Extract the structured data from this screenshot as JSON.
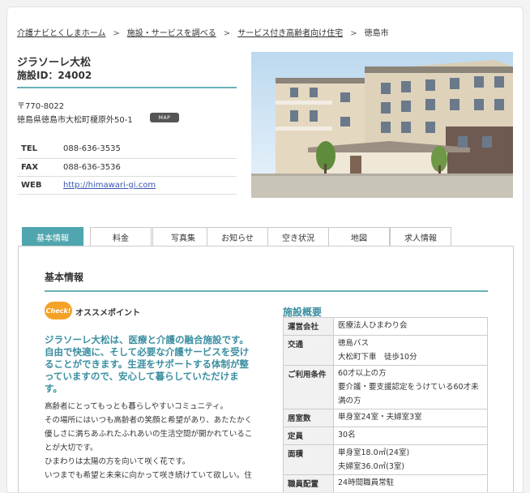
{
  "breadcrumb": {
    "items": [
      "介護ナビとくしまホーム",
      "施設・サービスを調べる",
      "サービス付き高齢者向け住宅",
      "徳島市"
    ],
    "separator": ">"
  },
  "facility": {
    "name": "ジラソーレ大松",
    "id_label": "施設ID：24002",
    "zip": "〒770-8022",
    "address": "徳島県徳島市大松町榎原外50-1",
    "map_label": "MAP",
    "contact": [
      {
        "key": "TEL",
        "value": "088-636-3535"
      },
      {
        "key": "FAX",
        "value": "088-636-3536"
      },
      {
        "key": "WEB",
        "value": "http://himawari-gi.com"
      }
    ]
  },
  "tabs": [
    "基本情報",
    "料金",
    "写真集",
    "お知らせ",
    "空き状況",
    "地図",
    "求人情報"
  ],
  "active_tab": "基本情報",
  "section": {
    "title": "基本情報",
    "check_badge": "Check!",
    "osusume_label": "オススメポイント",
    "lead": "ジラソーレ大松は、医療と介護の融合施設です。自由で快適に、そして必要な介護サービスを受けることができます。生涯をサポートする体制が整っていますので、安心して暮らしていただけます。",
    "body_lines": [
      "高齢者にとってもっとも暮らしやすいコミュニティ。",
      "その場所にはいつも高齢者の笑顔と希望があり、あたたかく",
      "優しさに満ちあふれたふれあいの生活空間が開かれているこ",
      "とが大切です。",
      "ひまわりは太陽の方を向いて咲く花です。",
      "いつまでも希望と未来に向かって咲き続けていて欲しい。住"
    ]
  },
  "overview": {
    "title": "施設概要",
    "rows": [
      {
        "key": "運営会社",
        "lines": [
          "医療法人ひまわり会"
        ]
      },
      {
        "key": "交通",
        "lines": [
          "徳島バス",
          "大松町下車　徒歩10分"
        ]
      },
      {
        "key": "ご利用条件",
        "lines": [
          "60才以上の方",
          "要介護・要支援認定をうけている60才未",
          "満の方"
        ]
      },
      {
        "key": "居室数",
        "lines": [
          "単身室24室・夫婦室3室"
        ]
      },
      {
        "key": "定員",
        "lines": [
          "30名"
        ]
      },
      {
        "key": "面積",
        "lines": [
          "単身室18.0㎡(24室)",
          "夫婦室36.0㎡(3室)"
        ]
      },
      {
        "key": "職員配置",
        "lines": [
          "24時間職員常駐"
        ]
      }
    ]
  },
  "colors": {
    "accent": "#4fa6ae",
    "lead": "#3a8ea0",
    "badge": "#f4a227",
    "link": "#3a56b0"
  }
}
